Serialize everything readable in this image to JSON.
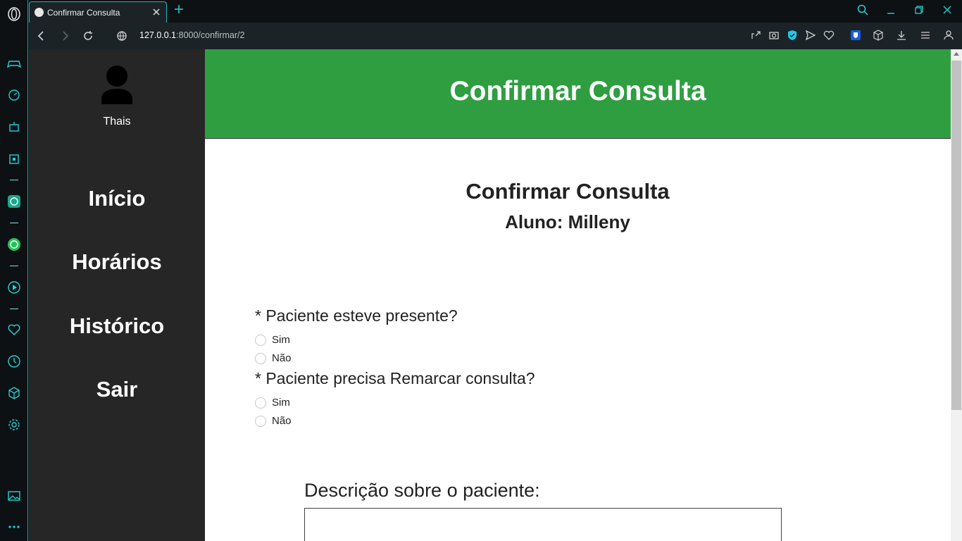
{
  "browser": {
    "tab": {
      "title": "Confirmar Consulta"
    },
    "address": {
      "host": "127.0.0.1",
      "rest": ":8000/confirmar/2"
    }
  },
  "sidebar": {
    "username": "Thais",
    "items": [
      {
        "label": "Início"
      },
      {
        "label": "Horários"
      },
      {
        "label": "Histórico"
      },
      {
        "label": "Sair"
      }
    ]
  },
  "header": {
    "title": "Confirmar Consulta"
  },
  "content": {
    "title": "Confirmar Consulta",
    "subtitle": "Aluno: Milleny",
    "questions": [
      {
        "label": "* Paciente esteve presente?",
        "options": [
          "Sim",
          "Não"
        ]
      },
      {
        "label": "* Paciente precisa Remarcar consulta?",
        "options": [
          "Sim",
          "Não"
        ]
      }
    ],
    "description_label": "Descrição sobre o paciente:"
  },
  "colors": {
    "header_bg": "#2f9e41",
    "sidebar_bg": "#262626",
    "browser_accent": "#15b8b8"
  }
}
